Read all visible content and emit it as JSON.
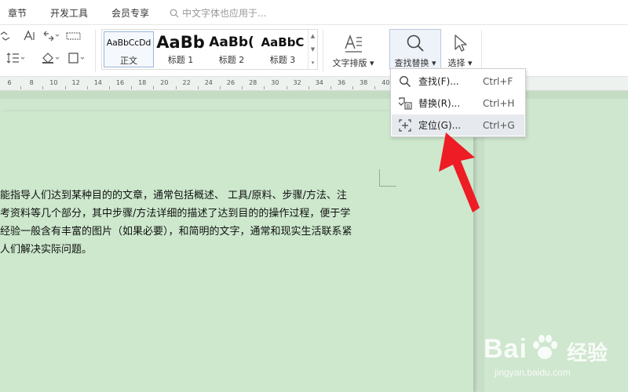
{
  "tabs": {
    "chapter": "章节",
    "devtools": "开发工具",
    "member": "会员专享",
    "search_placeholder": "中文字体也应用于..."
  },
  "styles": [
    {
      "preview": "AaBbCcDd",
      "label": "正文"
    },
    {
      "preview": "AaBb",
      "label": "标题 1"
    },
    {
      "preview": "AaBb(",
      "label": "标题 2"
    },
    {
      "preview": "AaBbC",
      "label": "标题 3"
    }
  ],
  "buttons": {
    "text_layout": "文字排版",
    "find_replace": "查找替换",
    "select": "选择"
  },
  "ruler": [
    "6",
    "8",
    "10",
    "12",
    "14",
    "16",
    "18",
    "20",
    "22",
    "24",
    "26",
    "28",
    "30",
    "32",
    "34",
    "36",
    "38",
    "40"
  ],
  "menu": [
    {
      "label": "查找(F)...",
      "shortcut": "Ctrl+F",
      "icon": "magnifier-icon"
    },
    {
      "label": "替换(R)...",
      "shortcut": "Ctrl+H",
      "icon": "replace-icon"
    },
    {
      "label": "定位(G)...",
      "shortcut": "Ctrl+G",
      "icon": "locate-icon"
    }
  ],
  "document": {
    "lines": [
      "能指导人们达到某种目的的文章，通常包括概述、 工具/原料、步骤/方法、注",
      "考资料等几个部分，其中步骤/方法详细的描述了达到目的的操作过程，便于学",
      "经验一般含有丰富的图片（如果必要），和简明的文字，通常和现实生活联系紧",
      "人们解决实际问题。"
    ]
  },
  "watermark": {
    "brand": "Bai",
    "brand_cn": "经验",
    "url": "jingyan.baidu.com"
  },
  "colors": {
    "page": "#cde8cd",
    "arrow": "#ee1c25",
    "menu_hover": "#e6e9ee"
  }
}
